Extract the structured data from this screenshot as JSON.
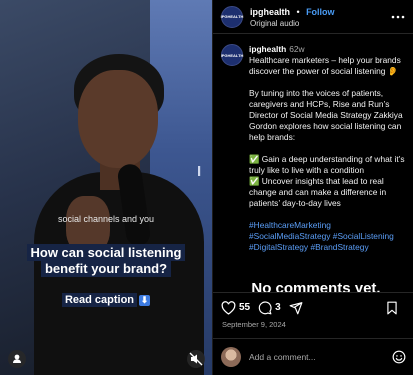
{
  "video": {
    "wall_text": "I",
    "subtitle": "social channels and you",
    "hook_line1": "How can social listening",
    "hook_line2": "benefit your brand?",
    "cta": "Read caption",
    "cta_icon": "arrow-down-emoji"
  },
  "header": {
    "avatar_text": "IPGHEALTH",
    "username": "ipghealth",
    "separator": "•",
    "follow_label": "Follow",
    "audio": "Original audio",
    "more_icon": "more-horizontal-icon"
  },
  "caption": {
    "username": "ipghealth",
    "age": "62w",
    "intro": "Healthcare marketers – help your brands discover the power of social listening 👂",
    "body": "By tuning into the voices of patients, caregivers and HCPs, Rise and Run’s Director of Social Media Strategy Zakkiya Gordon explores how social listening can help brands:",
    "bullet1": "✅ Gain a deep understanding of what it’s truly like to live with a condition",
    "bullet2": "✅ Uncover insights that lead to real change and can make a difference in patients’ day-to-day lives",
    "hashtags": "#HealthcareMarketing #SocialMediaStrategy #SocialListening #DigitalStrategy #BrandStrategy"
  },
  "no_comments": "No comments yet.",
  "actions": {
    "likes": "55",
    "comments": "3"
  },
  "date": "September 9, 2024",
  "comment_box": {
    "placeholder": "Add a comment..."
  },
  "colors": {
    "accent_link": "#4a9cf5",
    "hashtag": "#5b9ef7",
    "caption_highlight": "#162445"
  }
}
